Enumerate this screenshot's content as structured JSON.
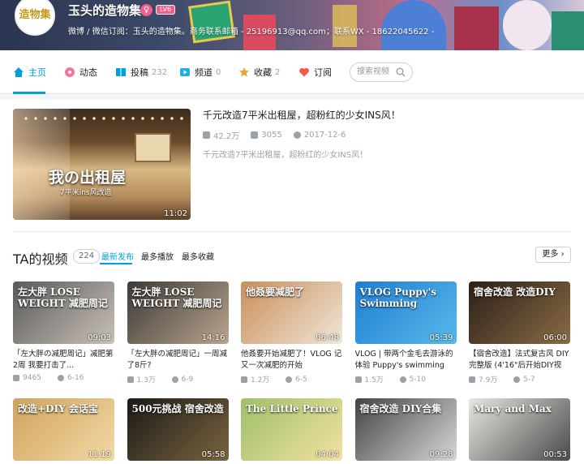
{
  "banner": {
    "avatar_text": "造物集",
    "username": "玉头的造物集",
    "level": "LV6",
    "sign": "微博 / 微信订阅：玉头的造物集。商务联系邮箱 - 25196913@qq.com；联系WX - 18622045622 -"
  },
  "nav": {
    "items": [
      {
        "label": "主页",
        "count": ""
      },
      {
        "label": "动态",
        "count": ""
      },
      {
        "label": "投稿",
        "count": "232"
      },
      {
        "label": "频道",
        "count": "0"
      },
      {
        "label": "收藏",
        "count": "2"
      },
      {
        "label": "订阅",
        "count": ""
      }
    ],
    "search_placeholder": "搜索视频"
  },
  "featured": {
    "thumb_title": "我の出租屋",
    "thumb_sub": "7平米ins风改造",
    "duration": "11:02",
    "title": "千元改造7平米出租屋，超粉红的少女INS风！",
    "views": "42.2万",
    "danmaku": "3055",
    "date": "2017-12-6",
    "desc": "千元改造7平米出租屋，超粉红的少女INS风！"
  },
  "videos_section": {
    "title": "TA的视频",
    "count": "224",
    "tabs": [
      "最新发布",
      "最多播放",
      "最多收藏"
    ],
    "more": "更多"
  },
  "videos": [
    {
      "thumb_text": "左大胖 LOSE WEIGHT 减肥周记",
      "duration": "09:03",
      "title": "「左大胖の减肥周记」减肥第2周 我要打击了...",
      "views": "9465",
      "date": "6-16",
      "colors": [
        "#5a5a5a",
        "#c9c1b7"
      ]
    },
    {
      "thumb_text": "左大胖 LOSE WEIGHT 减肥周记",
      "duration": "14:16",
      "title": "「左大胖の减肥周记」一周减了8斤?",
      "views": "1.3万",
      "date": "6-9",
      "colors": [
        "#3d3a36",
        "#b9a58e"
      ]
    },
    {
      "thumb_text": "他叒要减肥了",
      "duration": "06:48",
      "title": "他叒要开始减肥了！VLOG 记又一次减肥的开始",
      "views": "1.2万",
      "date": "6-5",
      "colors": [
        "#c98f5a",
        "#f0e6d8"
      ]
    },
    {
      "thumb_text": "VLOG Puppy's Swimming",
      "duration": "05:39",
      "title": "VLOG | 带两个金毛去游泳的体验 Puppy's swimming",
      "views": "1.5万",
      "date": "5-10",
      "colors": [
        "#1f7fd0",
        "#58b8ea"
      ]
    },
    {
      "thumb_text": "宿舍改造 改造DIY",
      "duration": "06:00",
      "title": "【宿舍改造】法式复古风 DIY完整版 (4'16\"后开始DIY视频)",
      "views": "7.9万",
      "date": "5-7",
      "colors": [
        "#2a2018",
        "#8b6b45"
      ]
    },
    {
      "thumb_text": "改造+DIY 会话宝",
      "duration": "11:19",
      "title": "",
      "views": "",
      "date": "",
      "colors": [
        "#d0a35c",
        "#f3d9a6"
      ]
    },
    {
      "thumb_text": "500元挑战 宿舍改造",
      "duration": "05:58",
      "title": "",
      "views": "",
      "date": "",
      "colors": [
        "#1b1a17",
        "#7a6440"
      ]
    },
    {
      "thumb_text": "The Little Prince",
      "duration": "04:04",
      "title": "",
      "views": "",
      "date": "",
      "colors": [
        "#9fbf6a",
        "#f2e2a2"
      ]
    },
    {
      "thumb_text": "宿舍改造 DIY合集",
      "duration": "09:28",
      "title": "",
      "views": "",
      "date": "",
      "colors": [
        "#444444",
        "#d8d8d8"
      ]
    },
    {
      "thumb_text": "Mary and Max",
      "duration": "00:53",
      "title": "",
      "views": "",
      "date": "",
      "colors": [
        "#e9e6e0",
        "#4a4a4a"
      ]
    }
  ]
}
